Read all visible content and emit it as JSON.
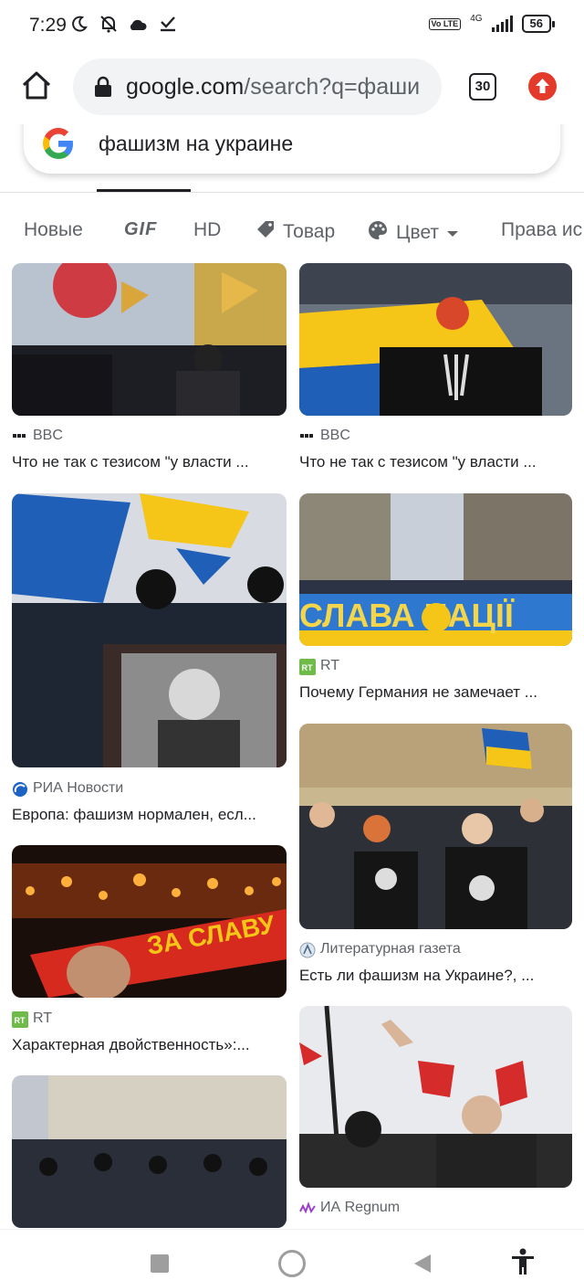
{
  "status": {
    "time": "7:29",
    "volte": "Vo LTE",
    "network": "4G",
    "battery": "56"
  },
  "browser": {
    "url_domain": "google.com",
    "url_path": "/search?q=фаши",
    "tab_count": "30"
  },
  "search": {
    "query": "фашизм на украине"
  },
  "chips": [
    "Новые",
    "GIF",
    "HD",
    "Товар",
    "Цвет",
    "Права ис"
  ],
  "results": [
    {
      "source": "BBC",
      "title": "Что не так с тезисом \"у власти ..."
    },
    {
      "source": "BBC",
      "title": "Что не так с тезисом \"у власти ..."
    },
    {
      "source": "РИА Новости",
      "title": "Европа: фашизм нормален, есл..."
    },
    {
      "source": "RT",
      "title": "Почему Германия не замечает ..."
    },
    {
      "source": "Литературная газета",
      "title": "Есть ли фашизм на Украине?, ..."
    },
    {
      "source": "RT",
      "title": "Характерная двойственность»:..."
    },
    {
      "source": "ИА Regnum",
      "title": ""
    }
  ],
  "image_text": {
    "banner_1": "СЛАВА НАЦІЇ",
    "banner_2": "ЗА СЛАВУ"
  },
  "colors": {
    "ukraine_blue": "#1f5fb8",
    "ukraine_yellow": "#f5c518",
    "update_red": "#e33a2c"
  }
}
